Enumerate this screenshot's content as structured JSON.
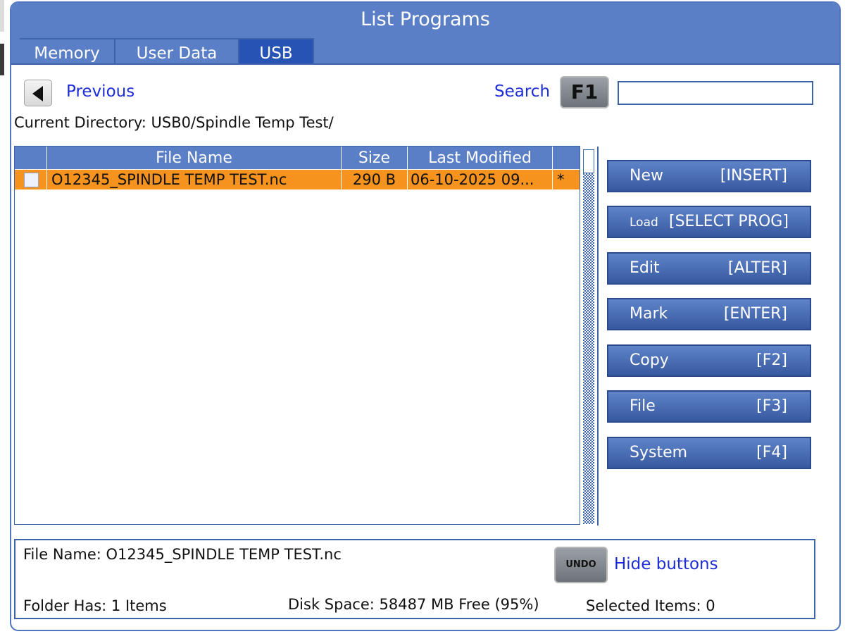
{
  "window": {
    "title": "List Programs"
  },
  "tabs": [
    {
      "label": "Memory",
      "active": false
    },
    {
      "label": "User Data",
      "active": false
    },
    {
      "label": "USB",
      "active": true
    }
  ],
  "navigation": {
    "previous_label": "Previous",
    "search_label": "Search",
    "search_key": "F1",
    "search_value": ""
  },
  "current_directory": "Current Directory: USB0/Spindle Temp Test/",
  "table": {
    "columns": [
      "",
      "File Name",
      "Size",
      "Last Modified",
      ""
    ],
    "rows": [
      {
        "checked": false,
        "file_name": "O12345_SPINDLE TEMP TEST.nc",
        "size": "290 B",
        "last_modified": "06-10-2025 09...",
        "marker": "*",
        "selected": true
      }
    ]
  },
  "actions": [
    {
      "label": "New",
      "key": "[INSERT]"
    },
    {
      "label": "Load",
      "key": "[SELECT PROG]"
    },
    {
      "label": "Edit",
      "key": "[ALTER]"
    },
    {
      "label": "Mark",
      "key": "[ENTER]"
    },
    {
      "label": "Copy",
      "key": "[F2]"
    },
    {
      "label": "File",
      "key": "[F3]"
    },
    {
      "label": "System",
      "key": "[F4]"
    }
  ],
  "status": {
    "file_name": "File Name: O12345_SPINDLE TEMP TEST.nc",
    "undo_key": "UNDO",
    "hide_buttons": "Hide buttons",
    "folder_has": "Folder Has: 1 Items",
    "disk_space": "Disk Space: 58487 MB Free (95%)",
    "selected_items": "Selected Items: 0"
  },
  "colors": {
    "accent": "#5b7fc6",
    "selected_row": "#f6931f",
    "link": "#1c2dd8"
  }
}
